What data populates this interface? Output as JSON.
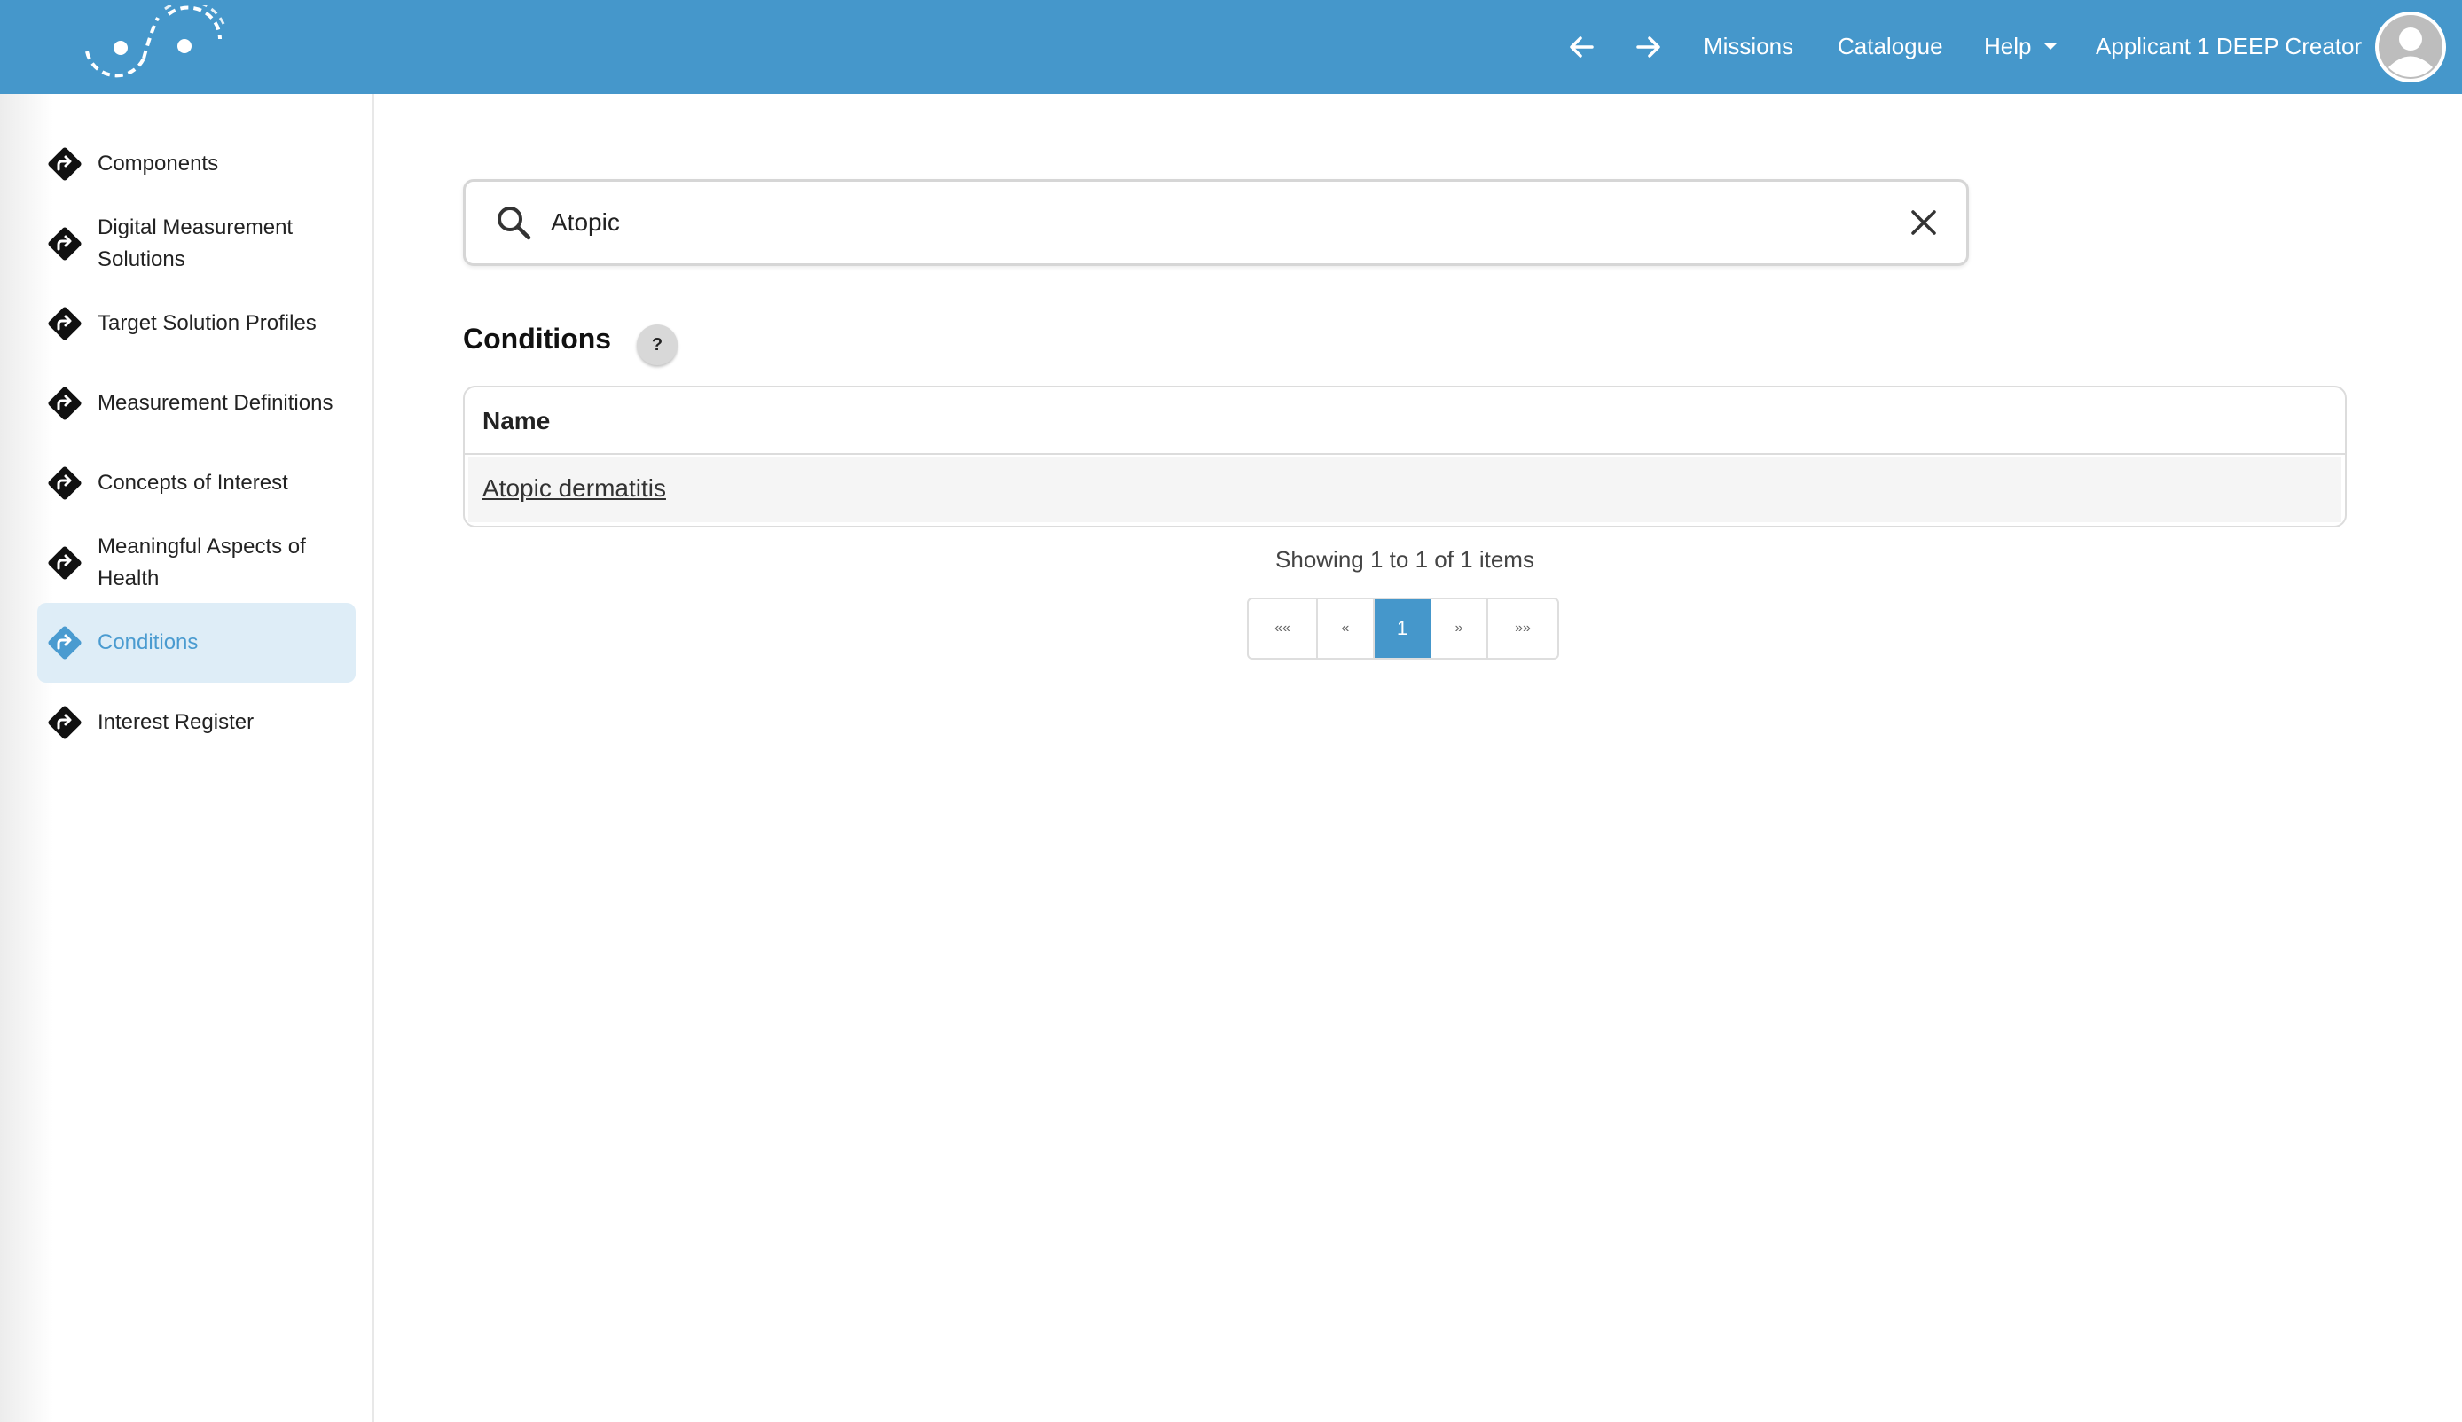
{
  "header": {
    "back_icon": "arrow-left-icon",
    "forward_icon": "arrow-right-icon",
    "nav": {
      "missions": "Missions",
      "catalogue": "Catalogue",
      "help": "Help"
    },
    "user_name": "Applicant 1 DEEP Creator",
    "avatar_icon": "user-avatar-icon",
    "brand_color": "#4597cb"
  },
  "sidebar": {
    "items": [
      {
        "label": "Components"
      },
      {
        "label": "Digital Measurement Solutions"
      },
      {
        "label": "Target Solution Profiles"
      },
      {
        "label": "Measurement Definitions"
      },
      {
        "label": "Concepts of Interest"
      },
      {
        "label": "Meaningful Aspects of Health"
      },
      {
        "label": "Conditions",
        "active": true
      },
      {
        "label": "Interest Register"
      }
    ],
    "item_icon": "directions-diamond-icon",
    "active_color": "#4a9bd0"
  },
  "search": {
    "value": "Atopic",
    "icon": "search-icon",
    "clear_icon": "close-icon"
  },
  "section": {
    "title": "Conditions",
    "help_label": "?"
  },
  "table": {
    "columns": [
      "Name"
    ],
    "rows": [
      {
        "name": "Atopic dermatitis"
      }
    ]
  },
  "pagination": {
    "summary": "Showing 1 to 1 of 1 items",
    "first": "««",
    "prev": "«",
    "current": "1",
    "next": "»",
    "last": "»»"
  }
}
